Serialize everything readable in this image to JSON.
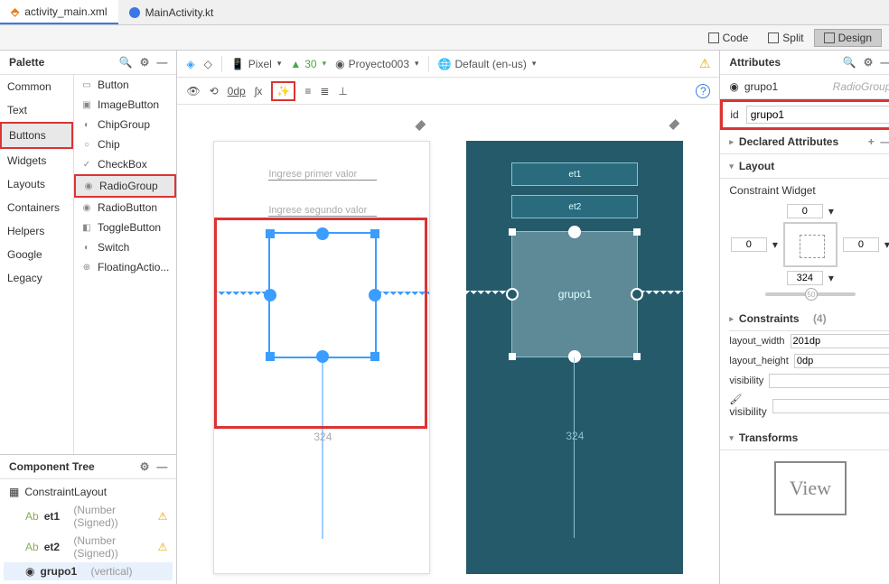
{
  "tabs": {
    "file1": "activity_main.xml",
    "file2": "MainActivity.kt"
  },
  "viewModes": {
    "code": "Code",
    "split": "Split",
    "design": "Design"
  },
  "palette": {
    "title": "Palette",
    "categories": [
      "Common",
      "Text",
      "Buttons",
      "Widgets",
      "Layouts",
      "Containers",
      "Helpers",
      "Google",
      "Legacy"
    ],
    "components": [
      "Button",
      "ImageButton",
      "ChipGroup",
      "Chip",
      "CheckBox",
      "RadioGroup",
      "RadioButton",
      "ToggleButton",
      "Switch",
      "FloatingActio..."
    ]
  },
  "tree": {
    "title": "Component Tree",
    "root": "ConstraintLayout",
    "items": [
      {
        "name": "et1",
        "sub": "(Number (Signed))"
      },
      {
        "name": "et2",
        "sub": "(Number (Signed))"
      },
      {
        "name": "grupo1",
        "sub": "(vertical)"
      }
    ]
  },
  "design": {
    "device": "Pixel",
    "api": "30",
    "project": "Proyecto003",
    "locale": "Default (en-us)",
    "zero": "0dp",
    "measure": "324",
    "inputs": {
      "t1": "Ingrese primer valor",
      "t2": "Ingrese segundo valor"
    },
    "bp": {
      "e1": "et1",
      "e2": "et2",
      "g": "grupo1"
    }
  },
  "attrs": {
    "title": "Attributes",
    "selName": "grupo1",
    "selType": "RadioGroup",
    "idLabel": "id",
    "idVal": "grupo1",
    "declared": "Declared Attributes",
    "layout": "Layout",
    "cwLabel": "Constraint Widget",
    "cwTop": "0",
    "cwLeft": "0",
    "cwRight": "0",
    "cwW": "324",
    "knob": "50",
    "constraints": "Constraints",
    "constraintsCount": "(4)",
    "lw": "layout_width",
    "lwVal": "201dp",
    "lh": "layout_height",
    "lhVal": "0dp",
    "vis": "visibility",
    "fvis": "visibility",
    "transforms": "Transforms",
    "viewPh": "View"
  }
}
